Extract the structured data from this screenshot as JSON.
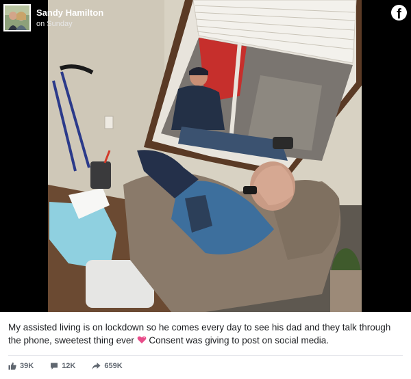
{
  "post": {
    "poster_name": "Sandy Hamilton",
    "timestamp": "on Sunday",
    "platform_icon": "facebook-logo-icon",
    "caption_before_emoji": "My assisted living is on lockdown so he comes every day to see his dad and they talk through the phone, sweetest thing ever",
    "caption_emoji": "sparkling-heart-icon",
    "caption_after_emoji": " Consent was giving to post on social media."
  },
  "stats": {
    "likes": "39K",
    "comments": "12K",
    "shares": "659K"
  },
  "colors": {
    "caption_text": "#1c1e21",
    "stats_text": "#606770",
    "heart": "#e84d8a"
  }
}
